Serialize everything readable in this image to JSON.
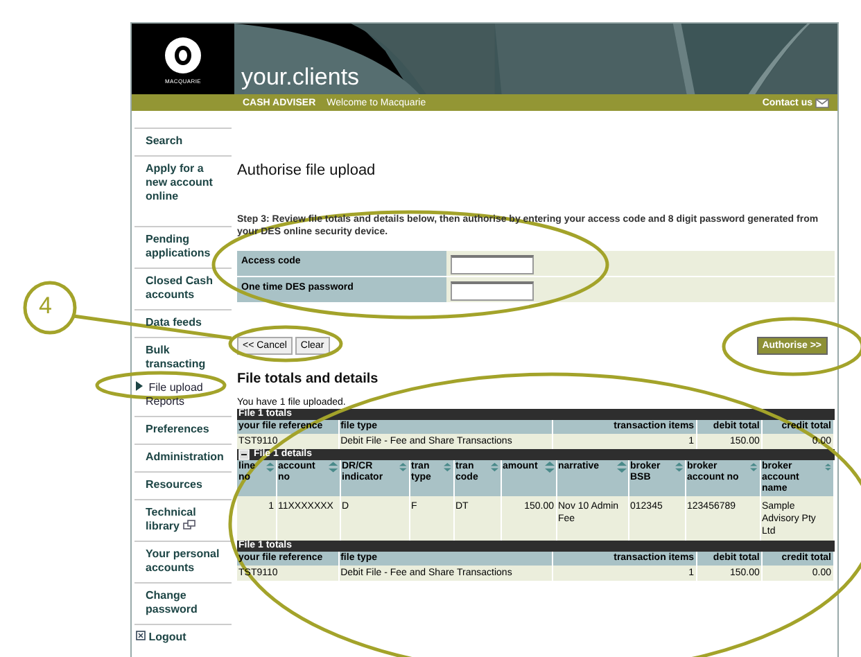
{
  "header": {
    "logo_text": "MACQUARIE",
    "site_title": "your.clients",
    "section": "CASH ADVISER",
    "welcome": "Welcome to Macquarie",
    "contact": "Contact us"
  },
  "sidebar": {
    "groups": [
      {
        "items": [
          {
            "label": "Search",
            "kind": "link",
            "selected": false
          }
        ]
      },
      {
        "items": [
          {
            "label": "Apply for a new account online",
            "kind": "link",
            "selected": false
          }
        ]
      },
      {
        "items": [
          {
            "label": "Pending applications",
            "kind": "link",
            "selected": false
          }
        ]
      },
      {
        "items": [
          {
            "label": "Closed Cash accounts",
            "kind": "link",
            "selected": false
          }
        ]
      },
      {
        "items": [
          {
            "label": "Data feeds",
            "kind": "link",
            "selected": false
          }
        ]
      },
      {
        "items": [
          {
            "label": "Bulk transacting",
            "kind": "link",
            "selected": false
          },
          {
            "label": "File upload",
            "kind": "sub",
            "selected": true
          },
          {
            "label": "Reports",
            "kind": "sub",
            "selected": false
          }
        ]
      },
      {
        "items": [
          {
            "label": "Preferences",
            "kind": "link",
            "selected": false
          }
        ]
      },
      {
        "items": [
          {
            "label": "Administration",
            "kind": "link",
            "selected": false
          }
        ]
      },
      {
        "items": [
          {
            "label": "Resources",
            "kind": "link",
            "selected": false
          }
        ]
      },
      {
        "items": [
          {
            "label": "Technical library",
            "kind": "external",
            "selected": false
          }
        ]
      },
      {
        "items": [
          {
            "label": "Your personal accounts",
            "kind": "link",
            "selected": false
          }
        ]
      },
      {
        "items": [
          {
            "label": "Change password",
            "kind": "link",
            "selected": false
          }
        ]
      },
      {
        "items": [
          {
            "label": "Logout",
            "kind": "logout",
            "selected": false
          }
        ]
      }
    ]
  },
  "page_title": "Authorise file upload",
  "instructions": "Step 3: Review file totals and details below, then authorise by entering your access code and 8 digit password generated from your DES online security device.",
  "form": {
    "fields": [
      {
        "label": "Access code"
      },
      {
        "label": "One time DES password"
      }
    ]
  },
  "buttons": {
    "cancel": "<< Cancel",
    "clear": "Clear",
    "authorise": "Authorise >>"
  },
  "section_title": "File totals and details",
  "upload_note": "You have 1 file uploaded.",
  "tables": [
    {
      "kind": "totals",
      "caption": "File 1 totals",
      "columns": [
        "your file reference",
        "file type",
        "transaction items",
        "debit total",
        "credit total"
      ],
      "rows": [
        [
          "TST9110",
          "Debit File - Fee and Share Transactions",
          "1",
          "150.00",
          "0.00"
        ]
      ]
    },
    {
      "kind": "details",
      "caption": "File 1 details",
      "columns": [
        "line no",
        "account no",
        "DR/CR indicator",
        "tran type",
        "tran code",
        "amount",
        "narrative",
        "broker BSB",
        "broker account no",
        "broker account name"
      ],
      "rows": [
        [
          "1",
          "11XXXXXXX",
          "D",
          "F",
          "DT",
          "150.00",
          "Nov 10 Admin Fee",
          "012345",
          "123456789",
          "Sample Advisory Pty Ltd"
        ]
      ]
    },
    {
      "kind": "totals",
      "caption": "File 1 totals",
      "columns": [
        "your file reference",
        "file type",
        "transaction items",
        "debit total",
        "credit total"
      ],
      "rows": [
        [
          "TST9110",
          "Debit File - Fee and Share Transactions",
          "1",
          "150.00",
          "0.00"
        ]
      ]
    }
  ],
  "annotation": {
    "callout": "4"
  }
}
